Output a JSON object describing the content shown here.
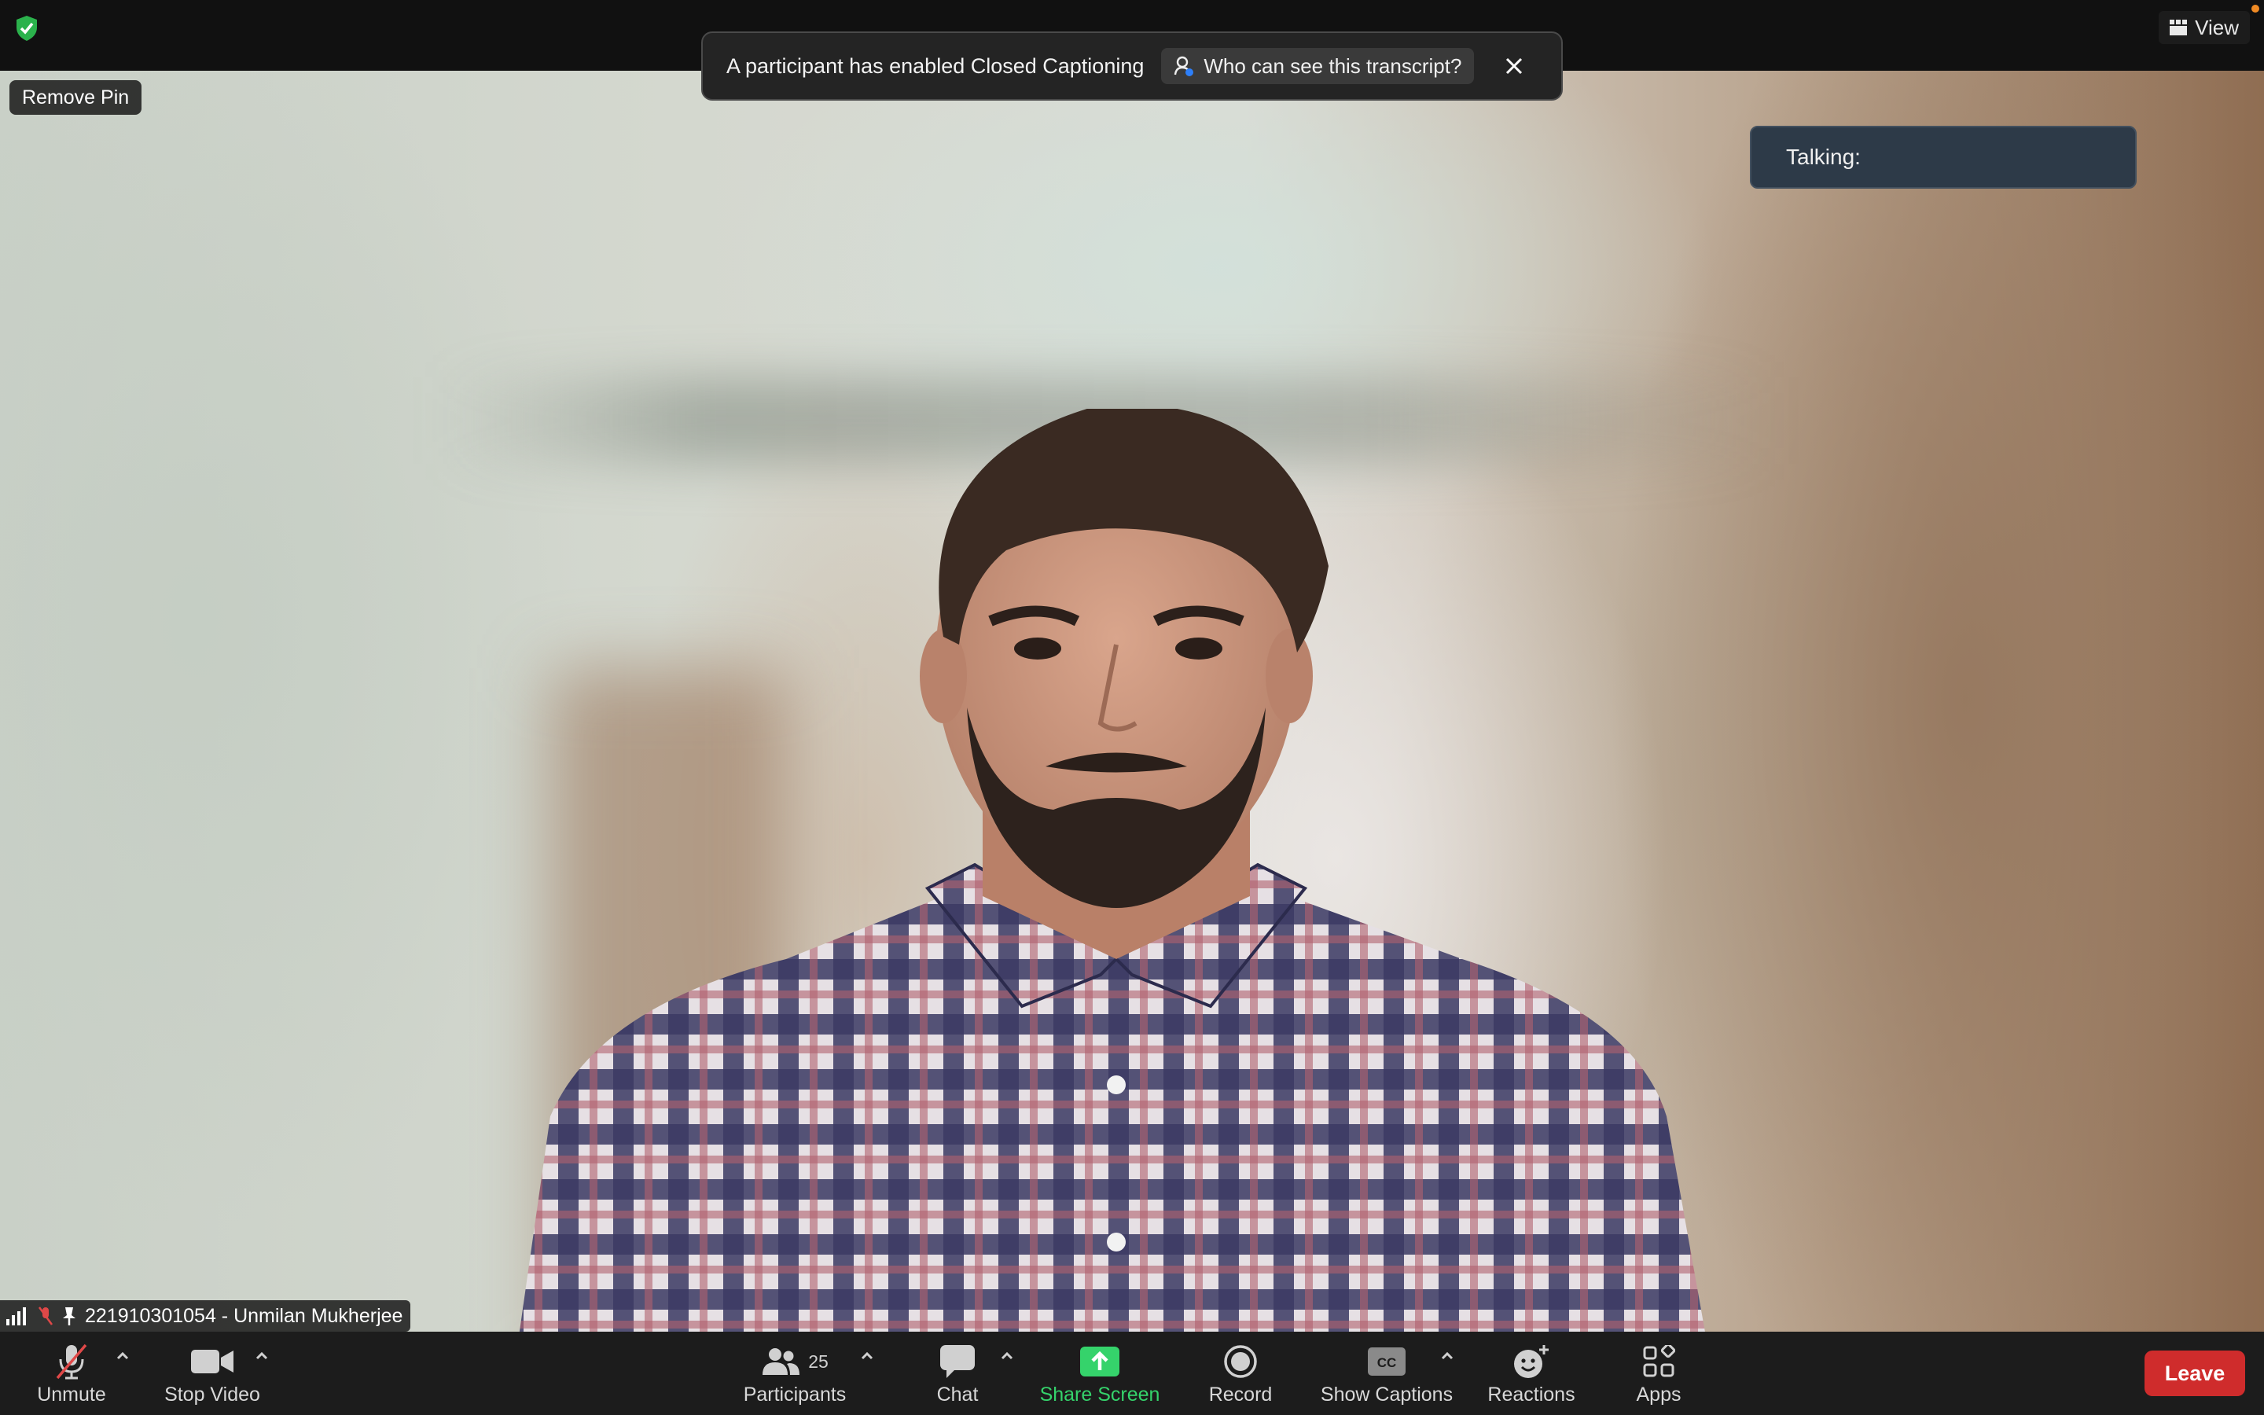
{
  "window": {
    "view_label": "View"
  },
  "banner": {
    "message": "A participant has enabled Closed Captioning",
    "link_label": "Who can see this transcript?"
  },
  "video": {
    "remove_pin_label": "Remove Pin",
    "talking_label": "Talking:",
    "participant_name": "221910301054 - Unmilan Mukherjee"
  },
  "toolbar": {
    "unmute": "Unmute",
    "stop_video": "Stop Video",
    "participants": "Participants",
    "participants_count": "25",
    "chat": "Chat",
    "share_screen": "Share Screen",
    "record": "Record",
    "show_captions": "Show Captions",
    "reactions": "Reactions",
    "apps": "Apps",
    "leave": "Leave",
    "captions_badge": "CC"
  },
  "colors": {
    "share_green": "#35d36b",
    "leave_red": "#cf2c2c",
    "security_green": "#2bb24c"
  },
  "icons": [
    "shield-icon",
    "grid-view-icon",
    "person-info-icon",
    "close-icon",
    "mic-muted-icon",
    "video-camera-icon",
    "participants-icon",
    "chat-bubble-icon",
    "share-screen-icon",
    "record-icon",
    "captions-icon",
    "reactions-icon",
    "apps-icon",
    "signal-icon",
    "pin-icon",
    "caret-up-icon"
  ]
}
